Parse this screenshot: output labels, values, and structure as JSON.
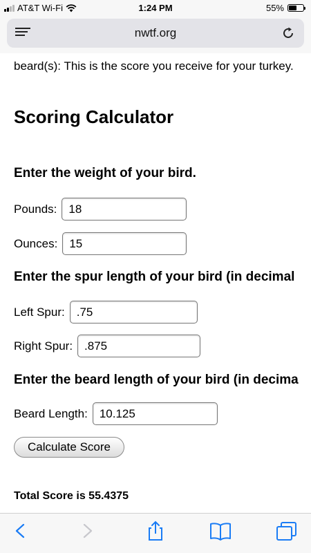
{
  "status_bar": {
    "carrier": "AT&T Wi-Fi",
    "time": "1:24 PM",
    "battery_text": "55%",
    "battery_level": 0.55
  },
  "browser": {
    "url": "nwtf.org"
  },
  "page": {
    "intro_text": "beard(s): This is the score you receive for your turkey.",
    "heading": "Scoring Calculator",
    "weight_section": {
      "title": "Enter the weight of your bird.",
      "pounds_label": "Pounds:",
      "pounds_value": "18",
      "ounces_label": "Ounces:",
      "ounces_value": "15"
    },
    "spur_section": {
      "title": "Enter the spur length of your bird (in decimal",
      "left_label": "Left Spur:",
      "left_value": ".75",
      "right_label": "Right Spur:",
      "right_value": ".875"
    },
    "beard_section": {
      "title": "Enter the beard length of your bird (in decima",
      "beard_label": "Beard Length:",
      "beard_value": "10.125"
    },
    "calculate_button": "Calculate Score",
    "total_text": "Total Score is 55.4375"
  },
  "toolbar": {
    "icons": [
      "back-icon",
      "forward-icon",
      "share-icon",
      "bookmarks-icon",
      "tabs-icon"
    ]
  },
  "colors": {
    "ios_blue": "#1a7cf5",
    "disabled_gray": "#c7c7cc",
    "chrome_bg": "#f7f7f7"
  }
}
